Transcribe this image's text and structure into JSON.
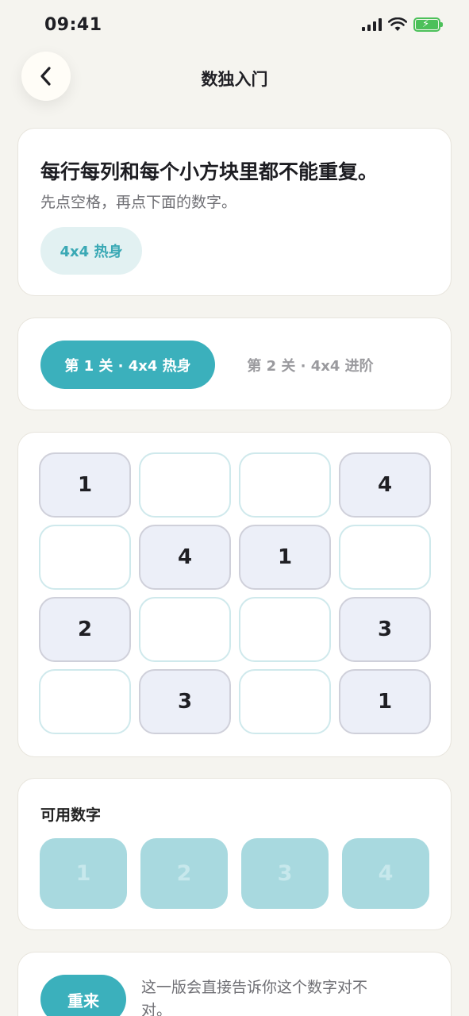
{
  "status_bar": {
    "time": "09:41"
  },
  "header": {
    "title": "数独入门"
  },
  "intro": {
    "heading": "每行每列和每个小方块里都不能重复。",
    "subtitle": "先点空格，再点下面的数字。",
    "level_badge": "4x4 热身"
  },
  "levels": [
    {
      "label": "第 1 关 · 4x4 热身",
      "active": true
    },
    {
      "label": "第 2 关 · 4x4 进阶",
      "active": false
    }
  ],
  "board": {
    "rows": [
      [
        "1",
        "",
        "",
        "4"
      ],
      [
        "",
        "4",
        "1",
        ""
      ],
      [
        "2",
        "",
        "",
        "3"
      ],
      [
        "",
        "3",
        "",
        "1"
      ]
    ]
  },
  "number_pad": {
    "label": "可用数字",
    "numbers": [
      "1",
      "2",
      "3",
      "4"
    ]
  },
  "actions": {
    "reset_label": "重来",
    "hint": "这一版会直接告诉你这个数字对不对。"
  },
  "colors": {
    "accent": "#3bb0bc",
    "background": "#f5f4ef",
    "given_cell": "#eceff8",
    "pad_button": "#a8d9df"
  }
}
